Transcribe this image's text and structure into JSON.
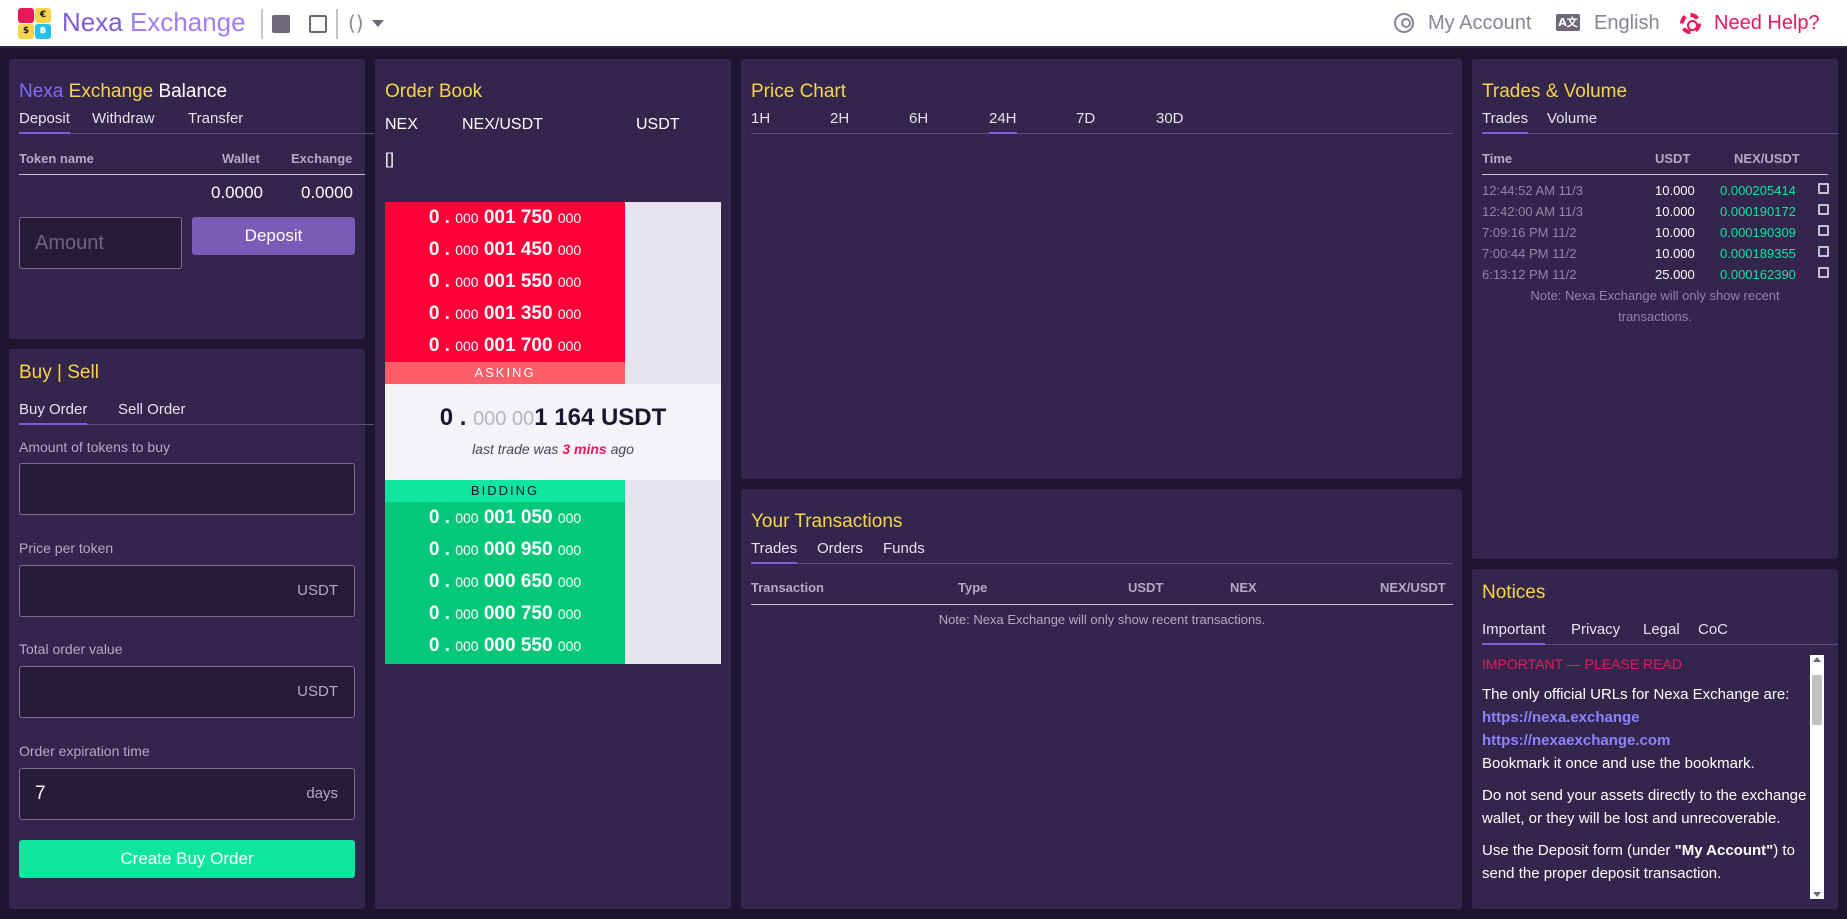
{
  "app": {
    "brand_part1": "Nexa",
    "brand_part2": "Exchange",
    "paren_label": "()",
    "my_account": "My Account",
    "language": "English",
    "help": "Need Help?"
  },
  "balance": {
    "title_part1": "Nexa",
    "title_part2": "Exchange",
    "title_part3": "Balance",
    "tabs": [
      "Deposit",
      "Withdraw",
      "Transfer"
    ],
    "col_token": "Token name",
    "col_wallet": "Wallet",
    "col_exchange": "Exchange",
    "wallet_value": "0.0000",
    "exchange_value": "0.0000",
    "amount_placeholder": "Amount",
    "deposit_button": "Deposit"
  },
  "buysell": {
    "title": "Buy | Sell",
    "tabs": [
      "Buy Order",
      "Sell Order"
    ],
    "amount_label": "Amount of tokens to buy",
    "price_label": "Price per token",
    "price_unit": "USDT",
    "total_label": "Total order value",
    "total_unit": "USDT",
    "expiration_label": "Order expiration time",
    "expiration_value": "7",
    "expiration_unit": "days",
    "create_button": "Create Buy Order"
  },
  "orderbook": {
    "title": "Order Book",
    "col_base": "NEX",
    "col_pair": "NEX/USDT",
    "col_quote": "USDT",
    "brackets": "[]",
    "asking_label": "ASKING",
    "bidding_label": "BIDDING",
    "asks": [
      {
        "a": "0 .",
        "b": "000",
        "c": "001 750",
        "d": "000"
      },
      {
        "a": "0 .",
        "b": "000",
        "c": "001 450",
        "d": "000"
      },
      {
        "a": "0 .",
        "b": "000",
        "c": "001 550",
        "d": "000"
      },
      {
        "a": "0 .",
        "b": "000",
        "c": "001 350",
        "d": "000"
      },
      {
        "a": "0 .",
        "b": "000",
        "c": "001 700",
        "d": "000"
      }
    ],
    "bids": [
      {
        "a": "0 .",
        "b": "000",
        "c": "001 050",
        "d": "000"
      },
      {
        "a": "0 .",
        "b": "000",
        "c": "000 950",
        "d": "000"
      },
      {
        "a": "0 .",
        "b": "000",
        "c": "000 650",
        "d": "000"
      },
      {
        "a": "0 .",
        "b": "000",
        "c": "000 750",
        "d": "000"
      },
      {
        "a": "0 .",
        "b": "000",
        "c": "000 550",
        "d": "000"
      }
    ],
    "last_price_int": "0 .",
    "last_price_dim": "000 00",
    "last_price_main": "1 164 USDT",
    "last_trade_prefix": "last trade was",
    "last_trade_time": "3 mins",
    "last_trade_suffix": "ago"
  },
  "pricechart": {
    "title": "Price Chart",
    "tabs": [
      "1H",
      "2H",
      "6H",
      "24H",
      "7D",
      "30D"
    ],
    "active_tab": "24H"
  },
  "transactions": {
    "title": "Your Transactions",
    "tabs": [
      "Trades",
      "Orders",
      "Funds"
    ],
    "cols": [
      "Transaction",
      "Type",
      "USDT",
      "NEX",
      "NEX/USDT"
    ],
    "note": "Note: Nexa Exchange will only show recent transactions."
  },
  "trades": {
    "title": "Trades & Volume",
    "tabs": [
      "Trades",
      "Volume"
    ],
    "col_time": "Time",
    "col_usdt": "USDT",
    "col_pair": "NEX/USDT",
    "rows": [
      {
        "time": "12:44:52 AM 11/3",
        "usdt": "10.000",
        "price": "0.000205414"
      },
      {
        "time": "12:42:00 AM 11/3",
        "usdt": "10.000",
        "price": "0.000190172"
      },
      {
        "time": "7:09:16 PM 11/2",
        "usdt": "10.000",
        "price": "0.000190309"
      },
      {
        "time": "7:00:44 PM 11/2",
        "usdt": "10.000",
        "price": "0.000189355"
      },
      {
        "time": "6:13:12 PM 11/2",
        "usdt": "25.000",
        "price": "0.000162390"
      }
    ],
    "note": "Note: Nexa Exchange will only show recent transactions."
  },
  "notices": {
    "title": "Notices",
    "tabs": [
      "Important",
      "Privacy",
      "Legal",
      "CoC"
    ],
    "heading": "IMPORTANT — PLEASE READ",
    "p1": "The only official URLs for Nexa Exchange are:",
    "url1": "https://nexa.exchange",
    "url2": "https://nexaexchange.com",
    "p1_tail": "Bookmark it once and use the bookmark.",
    "p2": "Do not send your assets directly to the exchange wallet, or they will be lost and unrecoverable.",
    "p3_pre": "Use the Deposit form (under ",
    "p3_bold": "\"My Account\"",
    "p3_post": ") to send the proper deposit transaction."
  },
  "colors": {
    "ask": "#ff0039",
    "bid": "#03c779",
    "accent": "#f5d54a",
    "brand": "#7b5cd6",
    "help": "#e8195b"
  }
}
